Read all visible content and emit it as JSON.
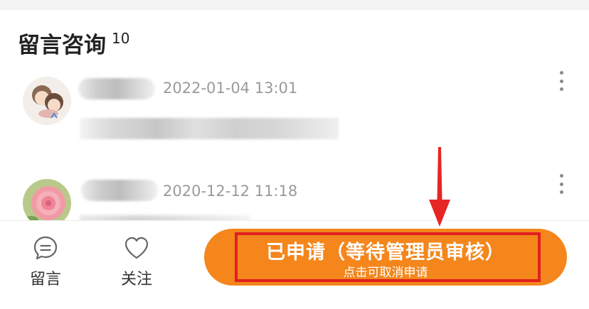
{
  "section": {
    "title": "留言咨询",
    "count": "10"
  },
  "comments": [
    {
      "timestamp": "2022-01-04 13:01",
      "avatar": "cartoon-couple-avatar"
    },
    {
      "timestamp": "2020-12-12 11:18",
      "avatar": "pink-rose-avatar"
    }
  ],
  "bottom_bar": {
    "message_label": "留言",
    "follow_label": "关注",
    "apply_main": "已申请（等待管理员审核）",
    "apply_sub": "点击可取消申请"
  },
  "colors": {
    "accent": "#f4861c",
    "highlight": "#e02020",
    "timestamp": "#9a9a9a"
  }
}
